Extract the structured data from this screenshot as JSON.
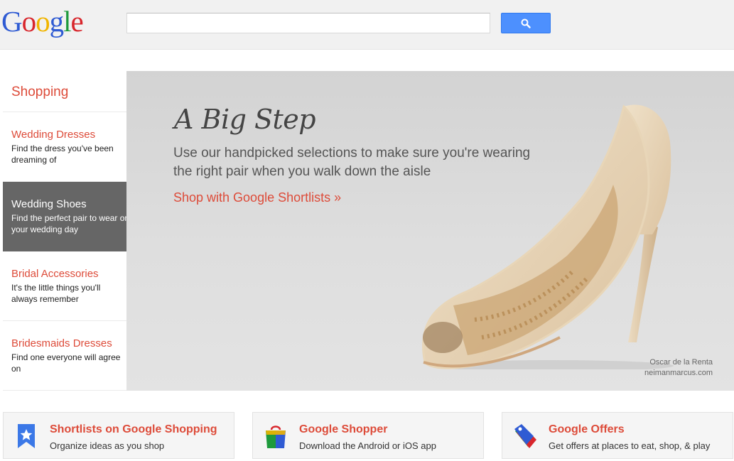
{
  "header": {
    "logo": [
      "G",
      "o",
      "o",
      "g",
      "l",
      "e"
    ],
    "logo_colors": [
      "#2f5bd3",
      "#d8262c",
      "#f1b500",
      "#2f5bd3",
      "#1e9a3c",
      "#d8262c"
    ],
    "search_value": "",
    "search_icon": "search-icon"
  },
  "sidebar": {
    "title": "Shopping",
    "items": [
      {
        "title": "Wedding Dresses",
        "desc": "Find the dress you've been dreaming of"
      },
      {
        "title": "Wedding Shoes",
        "desc": "Find the perfect pair to wear on your wedding day",
        "active": true
      },
      {
        "title": "Bridal Accessories",
        "desc": "It's the little things you'll always remember"
      },
      {
        "title": "Bridesmaids Dresses",
        "desc": "Find one everyone will agree on"
      }
    ]
  },
  "hero": {
    "title": "A Big Step",
    "text": "Use our handpicked selections to make sure you're wearing the right pair when you walk down the aisle",
    "link": "Shop with Google Shortlists »",
    "credit_line1": "Oscar de la Renta",
    "credit_line2": "neimanmarcus.com"
  },
  "cards": [
    {
      "title": "Shortlists on Google Shopping",
      "desc": "Organize ideas as you shop",
      "icon": "bookmark-star-icon"
    },
    {
      "title": "Google Shopper",
      "desc": "Download the Android or iOS app",
      "icon": "shopping-bag-icon"
    },
    {
      "title": "Google Offers",
      "desc": "Get offers at places to eat, shop, & play",
      "icon": "tag-icon"
    }
  ],
  "colors": {
    "accent_red": "#dd4b39",
    "search_blue": "#4d90fe",
    "active_gray": "#666666"
  }
}
